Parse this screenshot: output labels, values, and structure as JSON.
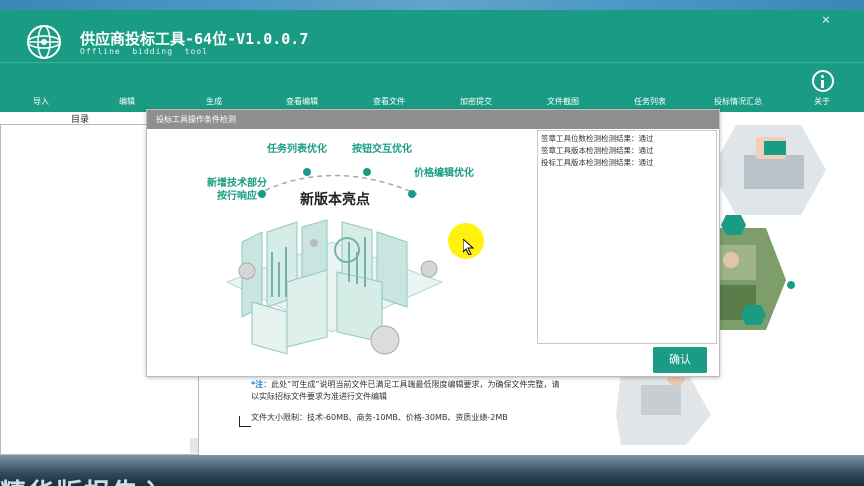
{
  "app": {
    "title": "供应商投标工具-64位-V1.0.0.7",
    "subtitle": "Offline  bidding  tool",
    "close_glyph": "×"
  },
  "nav": {
    "items": [
      {
        "label": "导入"
      },
      {
        "label": "编辑"
      },
      {
        "label": "生成"
      },
      {
        "label": "查看编辑"
      },
      {
        "label": "查看文件"
      },
      {
        "label": "加密提交"
      },
      {
        "label": "文件截图"
      },
      {
        "label": "任务列表"
      },
      {
        "label": "投标情况汇总"
      },
      {
        "label": "关于",
        "icon": "info-icon"
      }
    ]
  },
  "sidebar": {
    "label": "目录"
  },
  "dialog": {
    "title": "投标工具操作条件检测",
    "illustration": {
      "headline": "新版本亮点",
      "features": [
        "新增技术部分",
        "按行响应",
        "任务列表优化",
        "按钮交互优化",
        "价格编辑优化"
      ]
    },
    "log_lines": [
      "签章工具位数检测检测结果：通过",
      "签章工具版本检测检测结果：通过",
      "投标工具版本检测检测结果：通过"
    ],
    "confirm_label": "确认"
  },
  "notes": {
    "star": "*注",
    "text": "：此处“可生成”说明当前文件已满足工具端最低限度编辑要求，为确保文件完整，请以实际招标文件要求为准进行文件编辑",
    "limit_title": "文件大小限制",
    "limit_text": "：技术-60MB、商务-10MB、价格-30MB、资质业绩-2MB"
  },
  "background": {
    "watermark": "精华版报告入"
  },
  "colors": {
    "brand": "#1a9c84",
    "dialog_header": "#8f8f8f",
    "cursor_highlight": "#fff200"
  }
}
